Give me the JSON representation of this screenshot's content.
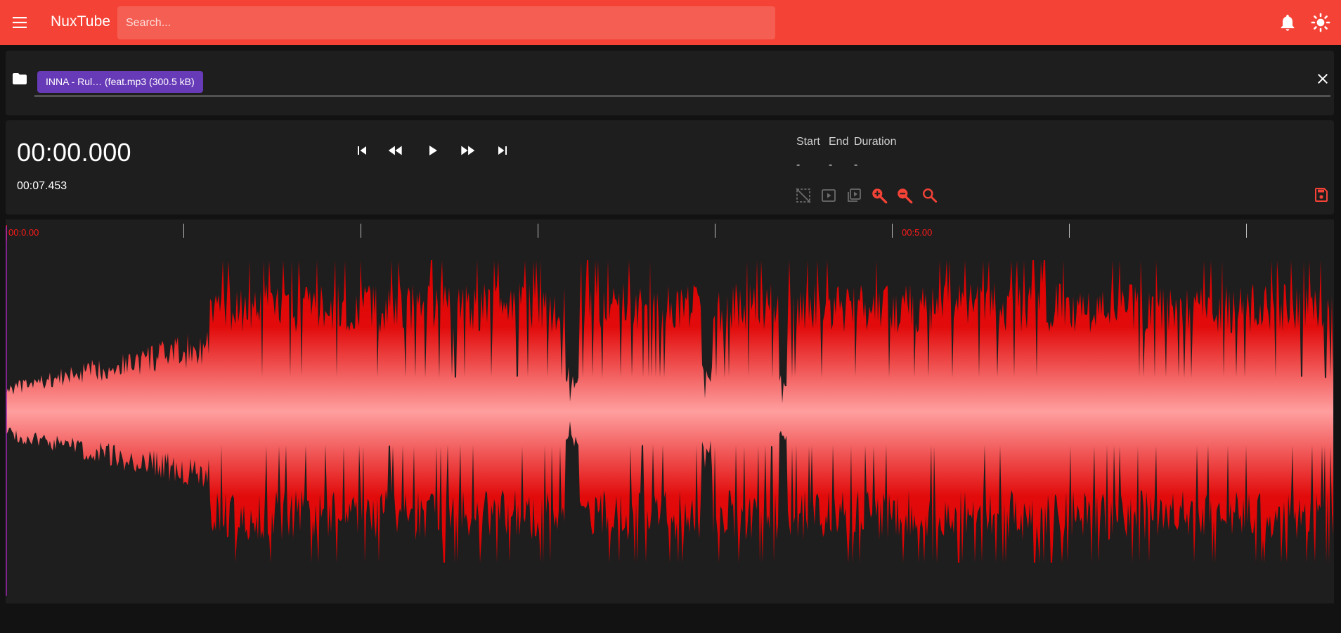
{
  "app": {
    "title": "NuxTube",
    "search_placeholder": "Search..."
  },
  "icons": {
    "menu": "menu-icon",
    "notifications": "bell-icon",
    "theme": "sun-icon",
    "folder": "folder-icon",
    "clear": "close-icon"
  },
  "file": {
    "chip_label": "INNA - Rul… (feat.mp3 (300.5 kB)"
  },
  "player": {
    "current_time": "00:00.000",
    "duration": "00:07.453",
    "controls": [
      "skip-previous",
      "rewind",
      "play",
      "fast-forward",
      "skip-next"
    ]
  },
  "region": {
    "start_label": "Start",
    "end_label": "End",
    "duration_label": "Duration",
    "start_value": "-",
    "end_value": "-",
    "duration_value": "-"
  },
  "waveform": {
    "timeline_labels": [
      "00:0.00",
      "00:5.00"
    ],
    "duration_seconds": 7.453,
    "playhead_seconds": 0,
    "colors": {
      "accent": "#f44336",
      "chip": "#673ab7",
      "wave_edge": "#dd0000",
      "wave_center": "#ff9f9f",
      "playhead": "#9c27b0",
      "tick_label": "#ff1a1a"
    }
  }
}
